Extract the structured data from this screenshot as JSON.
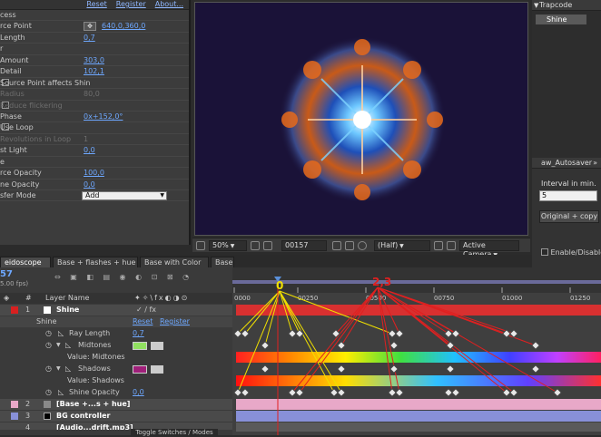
{
  "effect_controls": {
    "links": [
      "Reset",
      "Register",
      "About..."
    ],
    "rows": [
      {
        "label": "cess",
        "value": ""
      },
      {
        "label": "rce Point",
        "value": "640,0,360,0",
        "icon": true
      },
      {
        "label": "Length",
        "value": "0,7"
      },
      {
        "label": "r",
        "value": ""
      },
      {
        "label": "Amount",
        "value": "303,0"
      },
      {
        "label": "Detail",
        "value": "102,1"
      },
      {
        "label": "Source Point affects Shin",
        "value": "",
        "checkbox": true
      },
      {
        "label": "Radius",
        "value": "80,0",
        "disabled": true
      },
      {
        "label": "Reduce flickering",
        "value": "",
        "checkbox": true,
        "disabled": true
      },
      {
        "label": "Phase",
        "value": "0x+152,0°"
      },
      {
        "label": "Use Loop",
        "value": "",
        "checkbox": true
      },
      {
        "label": "Revolutions in Loop",
        "value": "1",
        "disabled": true
      },
      {
        "label": "st Light",
        "value": "0,0"
      },
      {
        "label": "e",
        "value": ""
      },
      {
        "label": "rce Opacity",
        "value": "100,0"
      },
      {
        "label": "ne Opacity",
        "value": "0,0"
      },
      {
        "label": "sfer Mode",
        "value": "Add",
        "dropdown": true
      }
    ]
  },
  "comp_viewer": {
    "zoom": "50%",
    "timecode": "00157",
    "resolution": "(Half)",
    "camera": "Active Camera"
  },
  "right_panels": {
    "trapcode_title": "Trapcode",
    "trapcode_item": "Shine",
    "autosaver_title": "aw_Autosaver",
    "interval_label": "Interval in min.",
    "interval_value": "5",
    "button_label": "Original + copy",
    "enable_label": "Enable/Disable au"
  },
  "timeline": {
    "tabs": [
      "eidoscope",
      "Base + flashes + hue",
      "Base with Color",
      "Base"
    ],
    "frame": "57",
    "fps": "5.00 fps)",
    "ruler": [
      "0000",
      "00250",
      "00500",
      "00750",
      "01000",
      "01250"
    ],
    "annotation_zero": "0",
    "annotation_23": "2,3",
    "col_number": "#",
    "col_layer_name": "Layer Name",
    "toggle_label": "Toggle Switches / Modes",
    "layer1": {
      "num": "1",
      "name": "Shine"
    },
    "effect_name": "Shine",
    "reset": "Reset",
    "register": "Register",
    "ray_length": {
      "label": "Ray Length",
      "value": "0,7"
    },
    "midtones": "Midtones",
    "value_midtones": "Value: Midtones",
    "shadows": "Shadows",
    "value_shadows": "Value: Shadows",
    "shine_opacity": {
      "label": "Shine Opacity",
      "value": "0,0"
    },
    "layer2": {
      "num": "2",
      "name": "[Base +...s + hue]"
    },
    "layer3": {
      "num": "3",
      "name": "BG controller"
    },
    "layer4": {
      "num": "4",
      "name": "[Audio...drift.mp3]"
    }
  },
  "colors": {
    "accent_link": "#6ea8ff",
    "annotation_red": "#e02020",
    "annotation_yellow": "#f0e000",
    "bar_layer1": "#d83030",
    "bar_layer2": "#e8a8c8",
    "bar_layer3": "#8890d8"
  }
}
